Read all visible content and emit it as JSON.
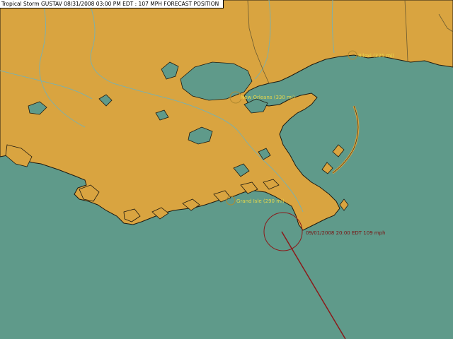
{
  "title": "Tropical Storm GUSTAV 08/31/2008 03:00 PM EDT : 107 MPH   FORECAST POSITION",
  "colors": {
    "water": "#5f9a8a",
    "land": "#d9a440",
    "coast": "#1e1a10",
    "river": "#7fb0a8",
    "boundary": "#6b5a30",
    "track": "#8b1a1a",
    "city_label": "#e8d84a",
    "forecast_label": "#7a1010"
  },
  "cities": [
    {
      "name": "city-biloxi",
      "label": "Biloxi (325 mi)"
    },
    {
      "name": "city-new-orleans",
      "label": "New Orleans (330 mi)"
    },
    {
      "name": "city-grand-isle",
      "label": "Grand Isle (290 mi)"
    }
  ],
  "forecast": {
    "label": "09/01/2008 20:00 EDT 109 mph"
  },
  "icons": [
    "storm-radius-circle",
    "city-marker-circle"
  ]
}
